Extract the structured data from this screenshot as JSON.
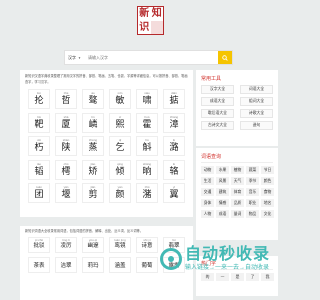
{
  "logo": {
    "chars": [
      "新",
      "知",
      "识",
      ""
    ]
  },
  "search": {
    "scope": "汉字",
    "placeholder": "请输入汉字"
  },
  "main": {
    "intro": "新知识汉语字典收录整理了常用汉字的拼音、部首、笔画、五笔、仓颉、字源等详细信息，可以按拼音、部首、笔画查字，学习汉字。",
    "chars": [
      {
        "py": "lún",
        "hz": "抡"
      },
      {
        "py": "zhé",
        "hz": "哲"
      },
      {
        "py": "ào",
        "hz": "骜"
      },
      {
        "py": "mǐn",
        "hz": "敏"
      },
      {
        "py": "xiào",
        "hz": "啸"
      },
      {
        "py": "diān",
        "hz": "掂"
      },
      {
        "py": "bǎ",
        "hz": "靶"
      },
      {
        "py": "shà",
        "hz": "厦"
      },
      {
        "py": "lín",
        "hz": "嶙"
      },
      {
        "py": "xī",
        "hz": "熙"
      },
      {
        "py": "huò",
        "hz": "霍"
      },
      {
        "py": "zhāng",
        "hz": "漳"
      },
      {
        "py": "xiǔ",
        "hz": "朽"
      },
      {
        "py": "shàn",
        "hz": "陕"
      },
      {
        "py": "zhēng",
        "hz": "蒸"
      },
      {
        "py": "qǐ",
        "hz": "乞"
      },
      {
        "py": "hú",
        "hz": "斛"
      },
      {
        "py": "lù",
        "hz": "潞"
      },
      {
        "py": "tāo",
        "hz": "韬"
      },
      {
        "py": "chū",
        "hz": "樗"
      },
      {
        "py": "jiǎo",
        "hz": "矫"
      },
      {
        "py": "qīng",
        "hz": "倾"
      },
      {
        "py": "shǎng",
        "hz": "晌"
      },
      {
        "py": "lù",
        "hz": "辂"
      },
      {
        "py": "tuán",
        "hz": "团"
      },
      {
        "py": "yǎn",
        "hz": "堰"
      },
      {
        "py": "jiǎn",
        "hz": "剪"
      },
      {
        "py": "yán",
        "hz": "颜"
      },
      {
        "py": "zhū",
        "hz": "潴"
      },
      {
        "py": "yì",
        "hz": "翼"
      }
    ]
  },
  "words": {
    "intro": "新知识词语大全收录常用词语，包括词语的拼音、解释、出处、近义词、反义词等。",
    "items": [
      {
        "py": "pī chǔ",
        "wd": "批驳"
      },
      {
        "py": "líng lì",
        "wd": "凌厉"
      },
      {
        "py": "yōu qì",
        "wd": "幽邃"
      },
      {
        "py": "luán jìng",
        "wd": "鸾镜"
      },
      {
        "py": "shī yì",
        "wd": "诗意"
      },
      {
        "py": "fēi",
        "wd": "翡翠"
      },
      {
        "py": "",
        "wd": "茶表"
      },
      {
        "py": "",
        "wd": "洁翠"
      },
      {
        "py": "",
        "wd": "莉玛"
      },
      {
        "py": "",
        "wd": "涵盖"
      },
      {
        "py": "",
        "wd": "葡萄"
      },
      {
        "py": "",
        "wd": "露露"
      }
    ]
  },
  "side_tools": {
    "title": "常用工具",
    "tags": [
      "汉字大全",
      "词语大全",
      "成语大全",
      "组词大全",
      "歇后语大全",
      "诗歌大全",
      "古诗文大全",
      "造句"
    ]
  },
  "side_radicals": {
    "title": "词语查询",
    "tags": [
      "动物",
      "水果",
      "植物",
      "蔬菜",
      "节日",
      "生活",
      "风景",
      "天气",
      "季节",
      "颜色",
      "交通",
      "建筑",
      "体育",
      "音乐",
      "食物",
      "身体",
      "情感",
      "品质",
      "职业",
      "地名",
      "人物",
      "成语",
      "量词",
      "物品",
      "文化"
    ]
  },
  "side_more": {
    "title": "热门字",
    "tags": [
      "的",
      "一",
      "是",
      "了",
      "我"
    ]
  },
  "watermark": {
    "big": "自动秒收录",
    "small": "输入链接→一来一去→自动收录"
  }
}
